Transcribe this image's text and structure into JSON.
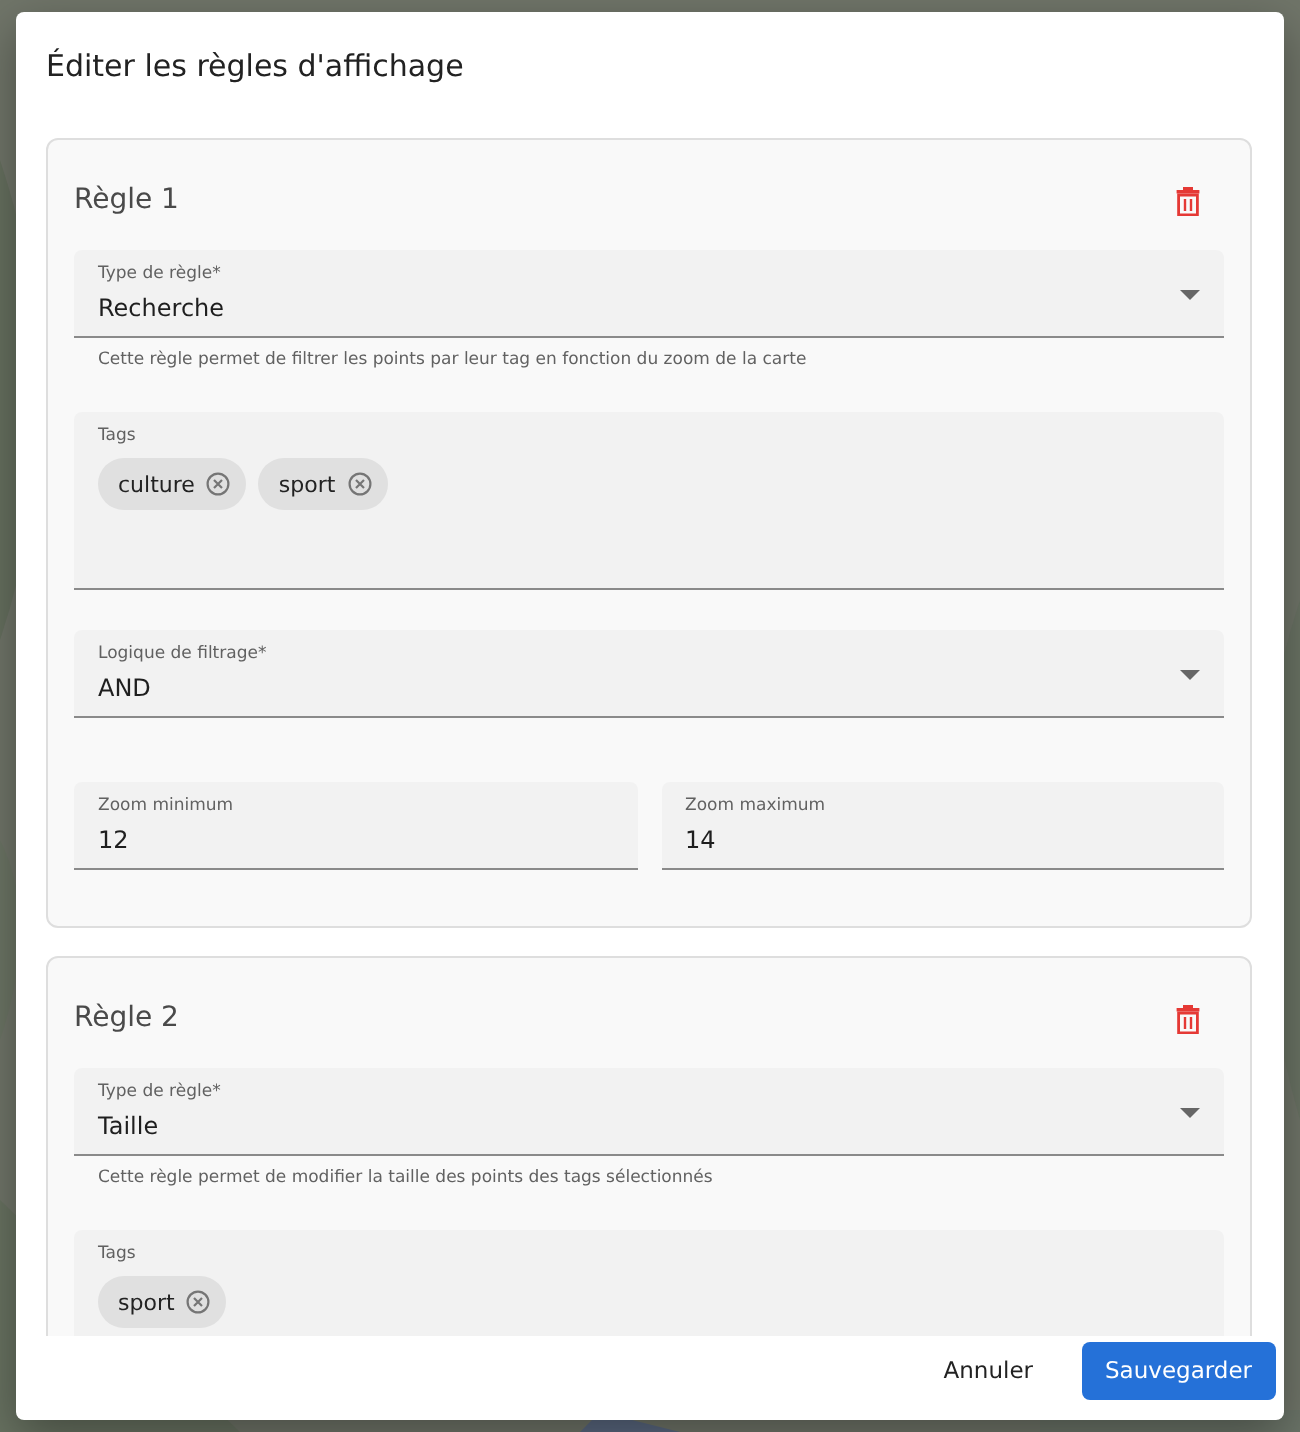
{
  "dialog": {
    "title": "Éditer les règles d'affichage",
    "rules": [
      {
        "title": "Règle 1",
        "fields": [
          {
            "kind": "select",
            "label": "Type de règle*",
            "value": "Recherche",
            "hint": "Cette règle permet de filtrer les points par leur tag en fonction du zoom de la carte"
          },
          {
            "kind": "tags",
            "label": "Tags",
            "tags": [
              "culture",
              "sport"
            ]
          },
          {
            "kind": "select",
            "label": "Logique de filtrage*",
            "value": "AND"
          },
          {
            "kind": "row",
            "fields": [
              {
                "kind": "text",
                "label": "Zoom minimum",
                "value": "12"
              },
              {
                "kind": "text",
                "label": "Zoom maximum",
                "value": "14"
              }
            ]
          }
        ]
      },
      {
        "title": "Règle 2",
        "fields": [
          {
            "kind": "select",
            "label": "Type de règle*",
            "value": "Taille",
            "hint": "Cette règle permet de modifier la taille des points des tags sélectionnés"
          },
          {
            "kind": "tags",
            "label": "Tags",
            "tags": [
              "sport"
            ]
          }
        ]
      }
    ],
    "buttons": [
      {
        "label": "Annuler",
        "kind": "text"
      },
      {
        "label": "Sauvegarder",
        "kind": "primary"
      }
    ]
  }
}
